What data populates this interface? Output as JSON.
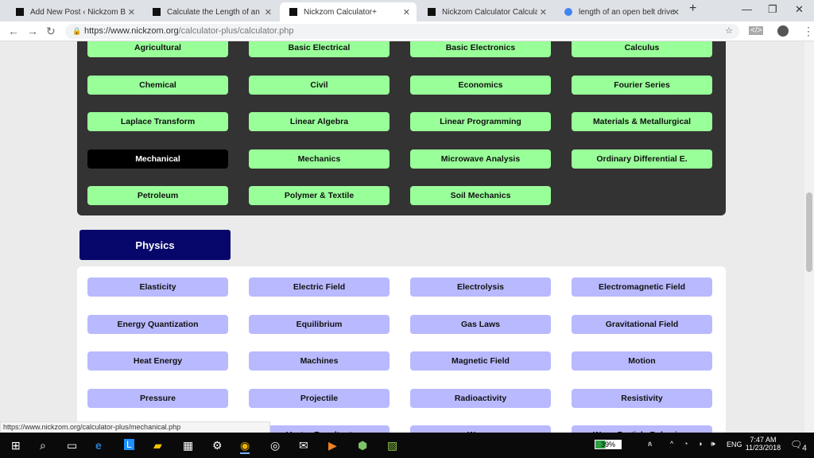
{
  "browser": {
    "tabs": [
      {
        "title": "Add New Post ‹ Nickzom Blog"
      },
      {
        "title": "Calculate the Length of an Ope"
      },
      {
        "title": "Nickzom Calculator+"
      },
      {
        "title": "Nickzom Calculator Calculates"
      },
      {
        "title": "length of an open belt drive - G"
      }
    ],
    "url_host": "https://www.nickzom.org",
    "url_path": "/calculator-plus/calculator.php",
    "status_url": "https://www.nickzom.org/calculator-plus/mechanical.php"
  },
  "engineering": {
    "items": [
      "Agricultural",
      "Basic Electrical",
      "Basic Electronics",
      "Calculus",
      "Chemical",
      "Civil",
      "Economics",
      "Fourier Series",
      "Laplace Transform",
      "Linear Algebra",
      "Linear Programming",
      "Materials & Metallurgical",
      "Mechanical",
      "Mechanics",
      "Microwave Analysis",
      "Ordinary Differential E.",
      "Petroleum",
      "Polymer & Textile",
      "Soil Mechanics"
    ],
    "selected": "Mechanical"
  },
  "physics": {
    "title": "Physics",
    "items": [
      "Elasticity",
      "Electric Field",
      "Electrolysis",
      "Electromagnetic Field",
      "Energy Quantization",
      "Equilibrium",
      "Gas Laws",
      "Gravitational Field",
      "Heat Energy",
      "Machines",
      "Magnetic Field",
      "Motion",
      "Pressure",
      "Projectile",
      "Radioactivity",
      "Resistivity",
      "",
      "Vector Resultant",
      "Waves",
      "Wave-Particle Behaviour"
    ]
  },
  "colors": {
    "green": "#99ff99",
    "lavender": "#b9b9ff",
    "navy": "#07076b",
    "dark_panel": "#333333"
  },
  "taskbar": {
    "battery": "39%",
    "lang": "ENG",
    "time": "7:47 AM",
    "date": "11/23/2018",
    "notifications": "4"
  }
}
